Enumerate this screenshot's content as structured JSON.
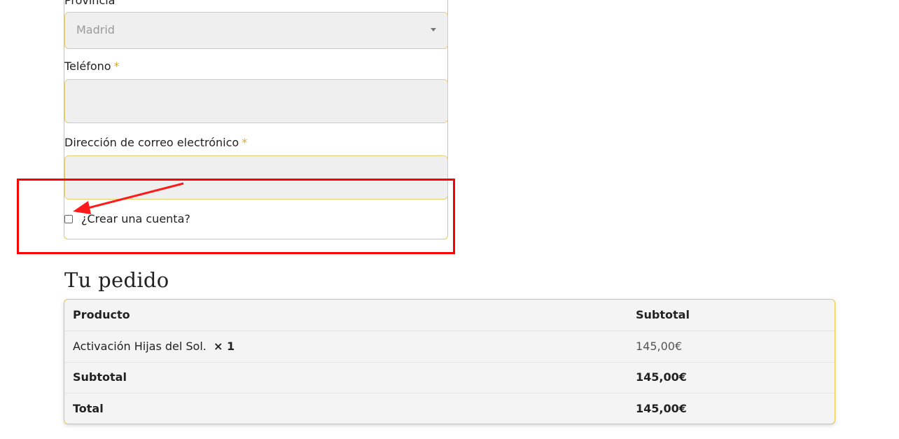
{
  "billing_form": {
    "province_label": "Provincia",
    "province_value": "Madrid",
    "phone_label": "Teléfono",
    "email_label": "Dirección de correo electrónico",
    "required_marker": "*",
    "create_account_label": "¿Crear una cuenta?"
  },
  "order": {
    "title": "Tu pedido",
    "header": {
      "product": "Producto",
      "subtotal": "Subtotal"
    },
    "items": [
      {
        "name": "Activación Hijas del Sol.",
        "qty": "× 1",
        "price": "145,00€"
      }
    ],
    "subtotal_label": "Subtotal",
    "subtotal_value": "145,00€",
    "total_label": "Total",
    "total_value": "145,00€"
  },
  "colors": {
    "accent_border": "#e6c84a",
    "required_star": "#d4ac2b",
    "annotation": "#ff0000",
    "field_bg": "#efefef"
  }
}
